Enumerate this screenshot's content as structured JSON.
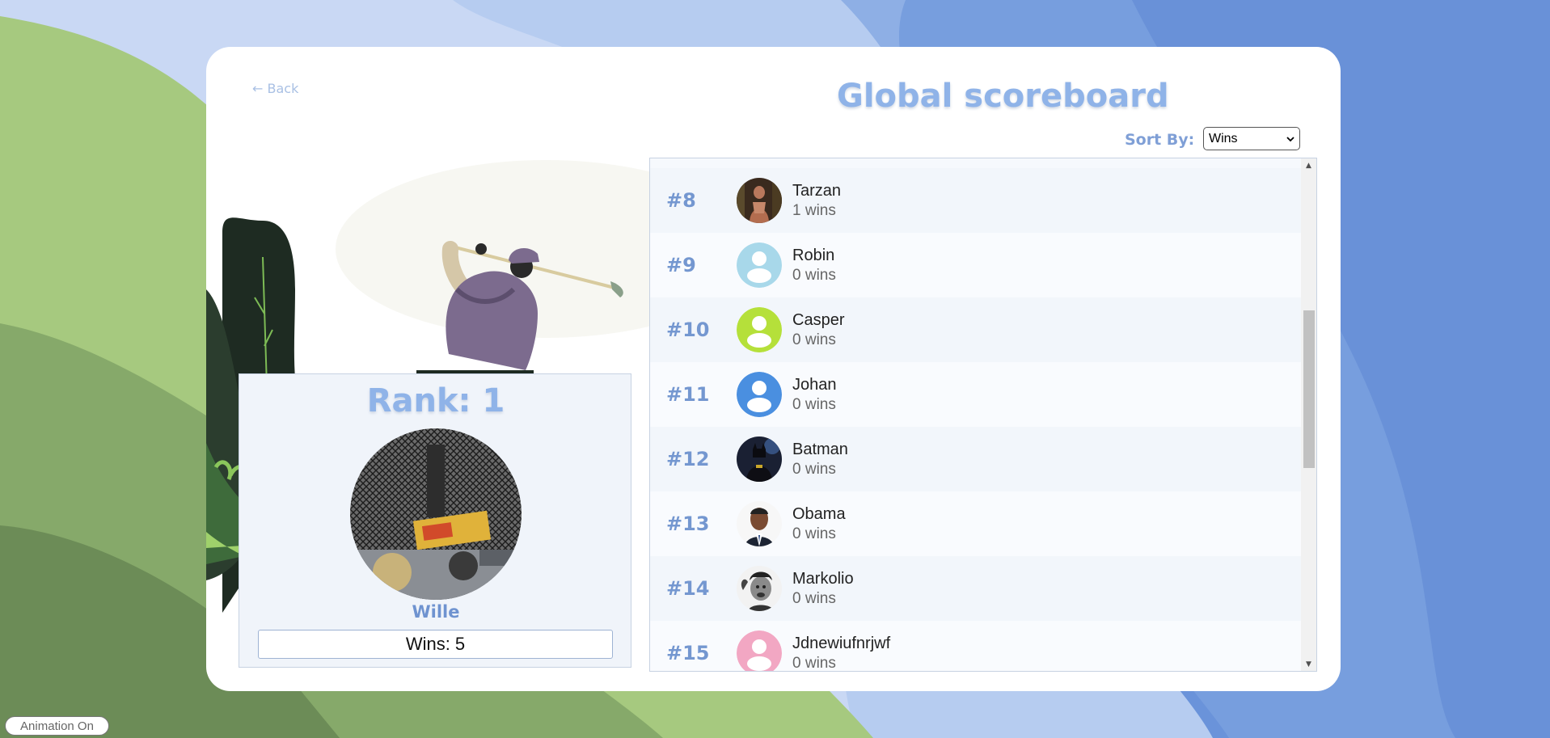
{
  "header": {
    "back_label": "← Back",
    "title": "Global scoreboard",
    "sort_label": "Sort By:",
    "sort_value": "Wins"
  },
  "current_user": {
    "rank_label": "Rank: 1",
    "name": "Wille",
    "wins_label": "Wins: 5"
  },
  "scoreboard": {
    "rows": [
      {
        "rank": "#8",
        "name": "Tarzan",
        "wins": "1 wins",
        "avatar": "photo-jungle"
      },
      {
        "rank": "#9",
        "name": "Robin",
        "wins": "0 wins",
        "avatar": "default-person-light-blue"
      },
      {
        "rank": "#10",
        "name": "Casper",
        "wins": "0 wins",
        "avatar": "default-person-lime"
      },
      {
        "rank": "#11",
        "name": "Johan",
        "wins": "0 wins",
        "avatar": "default-person-blue"
      },
      {
        "rank": "#12",
        "name": "Batman",
        "wins": "0 wins",
        "avatar": "photo-batman"
      },
      {
        "rank": "#13",
        "name": "Obama",
        "wins": "0 wins",
        "avatar": "photo-portrait"
      },
      {
        "rank": "#14",
        "name": "Markolio",
        "wins": "0 wins",
        "avatar": "photo-portrait-bw"
      },
      {
        "rank": "#15",
        "name": "Jdnewiufnrjwf",
        "wins": "0 wins",
        "avatar": "default-person-pink"
      }
    ]
  },
  "footer": {
    "animation_toggle_label": "Animation On"
  },
  "colors": {
    "accent": "#8fb3e8",
    "rank_text": "#7497d0",
    "light_blue": "#a8d8ea",
    "lime": "#b5e03a",
    "blue": "#4a8fe0",
    "pink": "#f2a7c3"
  }
}
